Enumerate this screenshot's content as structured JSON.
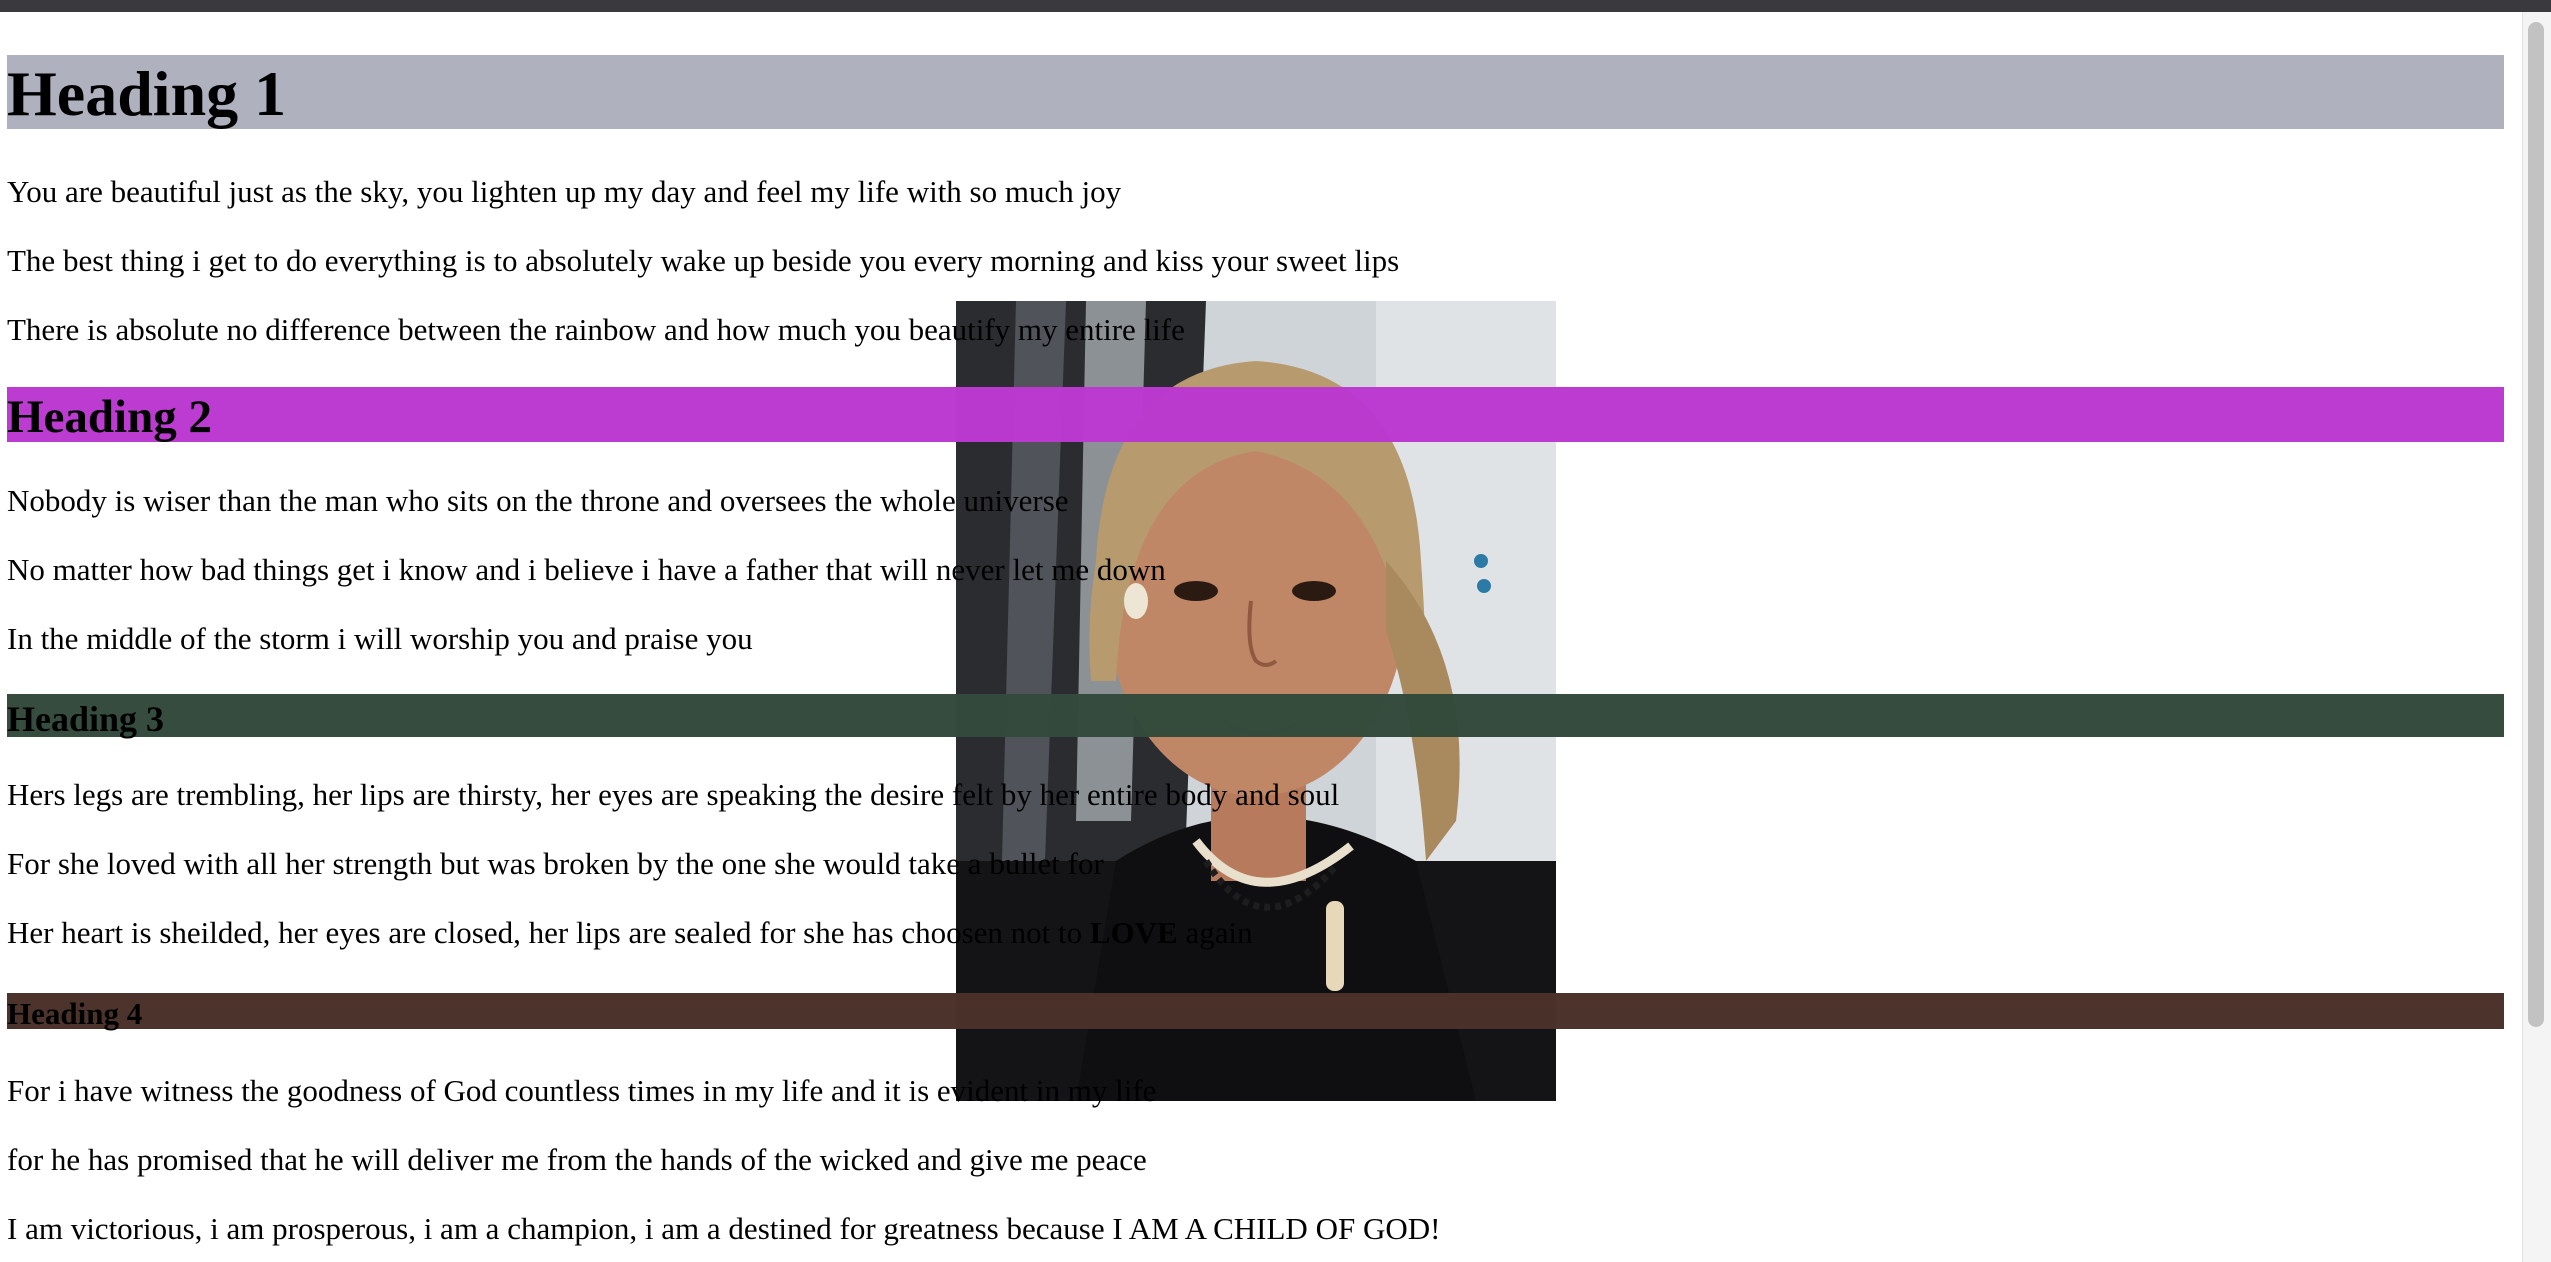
{
  "headings": [
    "Heading 1",
    "Heading 2",
    "Heading 3",
    "Heading 4"
  ],
  "heading_colors": [
    "#aeb0be",
    "#bb39cf",
    "#334a3c",
    "#4a3129"
  ],
  "section1": [
    "You are beautiful just as the sky, you lighten up my day and feel my life with so much joy",
    "The best thing i get to do everything is to absolutely wake up beside you every morning and kiss your sweet lips",
    "There is absolute no difference between the rainbow and how much you beautify my entire life"
  ],
  "section2": [
    "Nobody is wiser than the man who sits on the throne and oversees the whole universe",
    "No matter how bad things get i know and i believe i have a father that will never let me down",
    "In the middle of the storm i will worship you and praise you"
  ],
  "section3": [
    "Hers legs are trembling, her lips are thirsty, her eyes are speaking the desire felt by her entire body and soul",
    "For she loved with all her strength but was broken by the one she would take a bullet for"
  ],
  "section3_last": {
    "before": "Her heart is sheilded, her eyes are closed, her lips are sealed for she has choosen not to ",
    "bold": "LOVE",
    "after": " again"
  },
  "section4": [
    "For i have witness the goodness of God countless times in my life and it is evident in my life",
    "for he has promised that he will deliver me from the hands of the wicked and give me peace",
    "I am victorious, i am prosperous, i am a champion, i am a destined for greatness because I AM A CHILD OF GOD!"
  ]
}
